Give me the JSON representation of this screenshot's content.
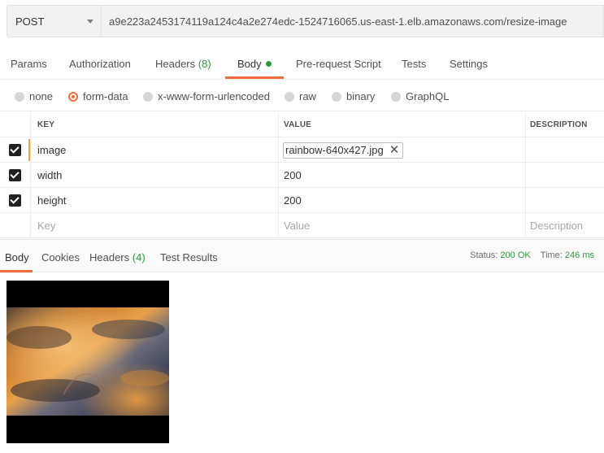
{
  "request": {
    "method": "POST",
    "url": "a9e223a2453174119a124c4a2e274edc-1524716065.us-east-1.elb.amazonaws.com/resize-image"
  },
  "tabs": [
    {
      "label": "Params"
    },
    {
      "label": "Authorization"
    },
    {
      "label": "Headers",
      "count": "(8)"
    },
    {
      "label": "Body"
    },
    {
      "label": "Pre-request Script"
    },
    {
      "label": "Tests"
    },
    {
      "label": "Settings"
    }
  ],
  "active_tab": "Body",
  "body_types": [
    {
      "label": "none"
    },
    {
      "label": "form-data"
    },
    {
      "label": "x-www-form-urlencoded"
    },
    {
      "label": "raw"
    },
    {
      "label": "binary"
    },
    {
      "label": "GraphQL"
    }
  ],
  "selected_body_type": "form-data",
  "table": {
    "headers": {
      "key": "KEY",
      "value": "VALUE",
      "description": "DESCRIPTION"
    },
    "rows": [
      {
        "checked": true,
        "key": "image",
        "value": "rainbow-640x427.jpg",
        "is_file": true,
        "remove_icon": "close-icon"
      },
      {
        "checked": true,
        "key": "width",
        "value": "200"
      },
      {
        "checked": true,
        "key": "height",
        "value": "200"
      }
    ],
    "placeholders": {
      "key": "Key",
      "value": "Value",
      "description": "Description"
    }
  },
  "response": {
    "tabs": [
      {
        "label": "Body"
      },
      {
        "label": "Cookies"
      },
      {
        "label": "Headers",
        "count": "(4)"
      },
      {
        "label": "Test Results"
      }
    ],
    "active_tab": "Body",
    "status_label": "Status:",
    "status_value": "200 OK",
    "time_label": "Time:",
    "time_value": "246 ms"
  },
  "colors": {
    "accent": "#f26b3a",
    "success": "#2d9a3a",
    "checkbox": "#212121"
  }
}
